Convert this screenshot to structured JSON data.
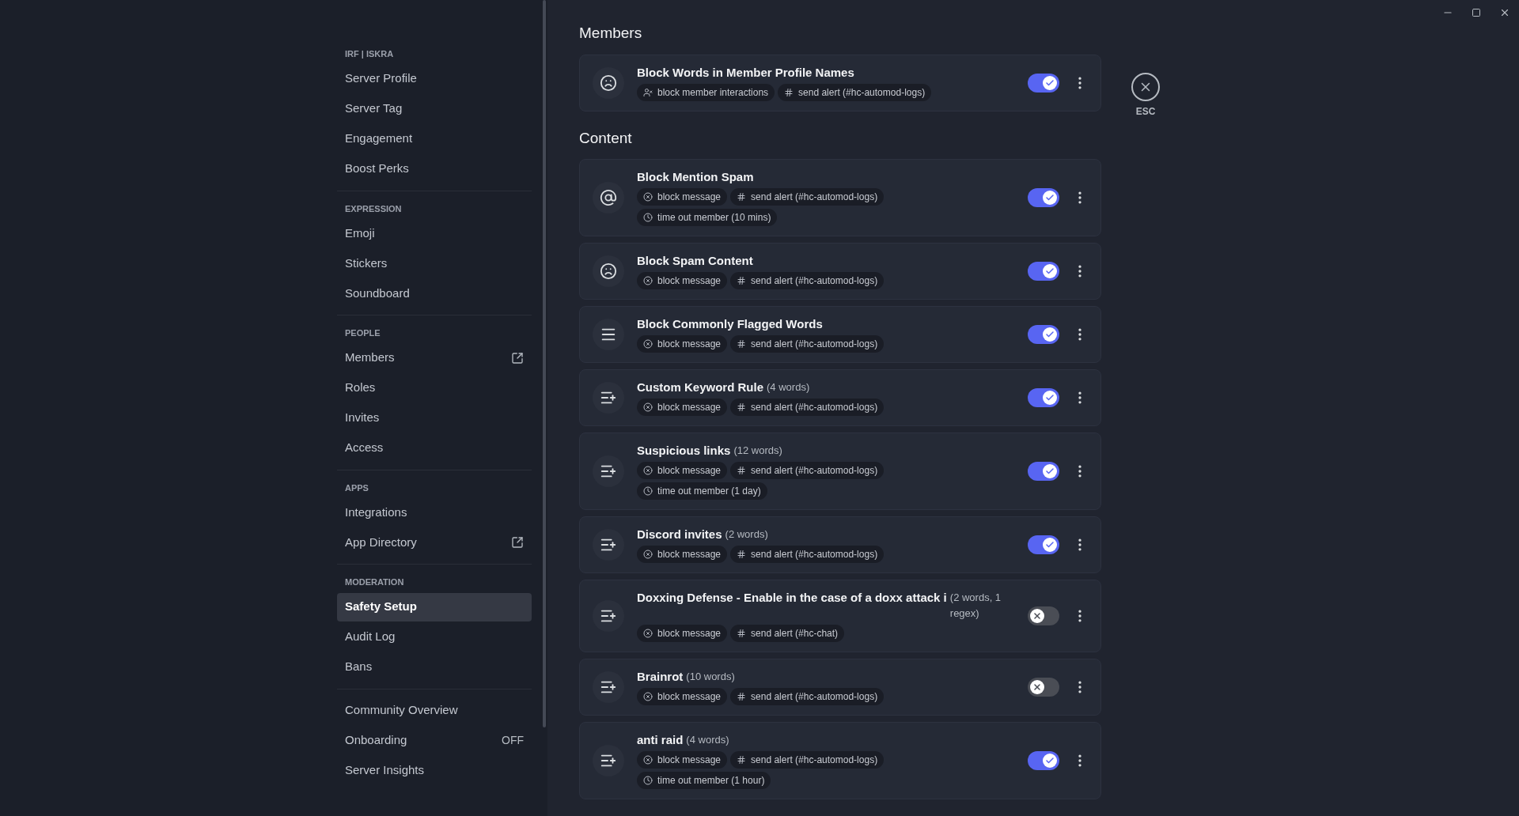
{
  "sidebar": {
    "sections": [
      {
        "header": "IRF | ISKRA",
        "items": [
          {
            "label": "Server Profile",
            "selected": false
          },
          {
            "label": "Server Tag",
            "selected": false
          },
          {
            "label": "Engagement",
            "selected": false
          },
          {
            "label": "Boost Perks",
            "selected": false
          }
        ]
      },
      {
        "header": "EXPRESSION",
        "items": [
          {
            "label": "Emoji",
            "selected": false
          },
          {
            "label": "Stickers",
            "selected": false
          },
          {
            "label": "Soundboard",
            "selected": false
          }
        ]
      },
      {
        "header": "PEOPLE",
        "items": [
          {
            "label": "Members",
            "selected": false,
            "external": true
          },
          {
            "label": "Roles",
            "selected": false
          },
          {
            "label": "Invites",
            "selected": false
          },
          {
            "label": "Access",
            "selected": false
          }
        ]
      },
      {
        "header": "APPS",
        "items": [
          {
            "label": "Integrations",
            "selected": false
          },
          {
            "label": "App Directory",
            "selected": false,
            "external": true
          }
        ]
      },
      {
        "header": "MODERATION",
        "items": [
          {
            "label": "Safety Setup",
            "selected": true
          },
          {
            "label": "Audit Log",
            "selected": false
          },
          {
            "label": "Bans",
            "selected": false
          }
        ]
      },
      {
        "items": [
          {
            "label": "Community Overview",
            "selected": false
          },
          {
            "label": "Onboarding",
            "selected": false,
            "value": "OFF"
          },
          {
            "label": "Server Insights",
            "selected": false
          }
        ]
      }
    ]
  },
  "groups": [
    {
      "heading": "Members",
      "rules": [
        {
          "kind": "face",
          "title": "Block Words in Member Profile Names",
          "on": true,
          "actions": [
            {
              "kind": "restrict",
              "label": "block member interactions"
            },
            {
              "kind": "alert",
              "label": "send alert (#hc-automod-logs)"
            }
          ]
        }
      ]
    },
    {
      "heading": "Content",
      "rules": [
        {
          "kind": "at",
          "title": "Block Mention Spam",
          "on": true,
          "actions": [
            {
              "kind": "block",
              "label": "block message"
            },
            {
              "kind": "alert",
              "label": "send alert (#hc-automod-logs)"
            },
            {
              "kind": "timeout",
              "label": "time out member (10 mins)"
            }
          ]
        },
        {
          "kind": "face",
          "title": "Block Spam Content",
          "on": true,
          "actions": [
            {
              "kind": "block",
              "label": "block message"
            },
            {
              "kind": "alert",
              "label": "send alert (#hc-automod-logs)"
            }
          ]
        },
        {
          "kind": "lines",
          "title": "Block Commonly Flagged Words",
          "on": true,
          "actions": [
            {
              "kind": "block",
              "label": "block message"
            },
            {
              "kind": "alert",
              "label": "send alert (#hc-automod-logs)"
            }
          ]
        },
        {
          "kind": "list",
          "title": "Custom Keyword Rule",
          "count": "(4 words)",
          "on": true,
          "actions": [
            {
              "kind": "block",
              "label": "block message"
            },
            {
              "kind": "alert",
              "label": "send alert (#hc-automod-logs)"
            }
          ]
        },
        {
          "kind": "list",
          "title": "Suspicious links",
          "count": "(12 words)",
          "on": true,
          "actions": [
            {
              "kind": "block",
              "label": "block message"
            },
            {
              "kind": "alert",
              "label": "send alert (#hc-automod-logs)"
            },
            {
              "kind": "timeout",
              "label": "time out member (1 day)"
            }
          ]
        },
        {
          "kind": "list",
          "title": "Discord invites",
          "count": "(2 words)",
          "on": true,
          "actions": [
            {
              "kind": "block",
              "label": "block message"
            },
            {
              "kind": "alert",
              "label": "send alert (#hc-automod-logs)"
            }
          ]
        },
        {
          "kind": "list",
          "title": "Doxxing Defense - Enable in the case of a doxx attack i",
          "count": "(2 words, 1 regex)",
          "on": false,
          "actions": [
            {
              "kind": "block",
              "label": "block message"
            },
            {
              "kind": "alert",
              "label": "send alert (#hc-chat)"
            }
          ]
        },
        {
          "kind": "list",
          "title": "Brainrot",
          "count": "(10 words)",
          "on": false,
          "actions": [
            {
              "kind": "block",
              "label": "block message"
            },
            {
              "kind": "alert",
              "label": "send alert (#hc-automod-logs)"
            }
          ]
        },
        {
          "kind": "list",
          "title": "anti raid",
          "count": "(4 words)",
          "on": true,
          "actions": [
            {
              "kind": "block",
              "label": "block message"
            },
            {
              "kind": "alert",
              "label": "send alert (#hc-automod-logs)"
            },
            {
              "kind": "timeout",
              "label": "time out member (1 hour)"
            }
          ]
        }
      ]
    }
  ],
  "close_button": {
    "label": "ESC"
  }
}
